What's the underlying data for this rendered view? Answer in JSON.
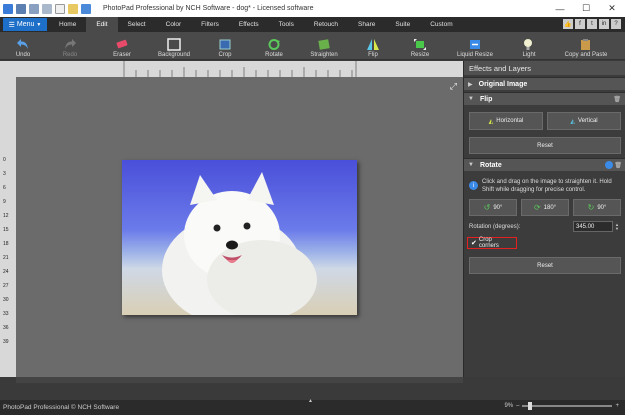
{
  "window": {
    "title": "PhotoPad Professional by NCH Software - dog* - Licensed software",
    "controls": [
      "—",
      "☐",
      "✕"
    ]
  },
  "menu": {
    "menu_label": "Menu",
    "tabs": [
      {
        "label": "Home"
      },
      {
        "label": "Edit",
        "active": true
      },
      {
        "label": "Select"
      },
      {
        "label": "Color"
      },
      {
        "label": "Filters"
      },
      {
        "label": "Effects"
      },
      {
        "label": "Tools"
      },
      {
        "label": "Retouch"
      },
      {
        "label": "Share"
      },
      {
        "label": "Suite"
      },
      {
        "label": "Custom"
      }
    ],
    "social": [
      "👍",
      "f",
      "t",
      "in",
      "?"
    ]
  },
  "toolbar": {
    "undo": "Undo",
    "redo": "Redo",
    "eraser": "Eraser",
    "background": "Background",
    "crop": "Crop",
    "rotate": "Rotate",
    "straighten": "Straighten",
    "flip": "Flip",
    "resize": "Resize",
    "liquid_resize": "Liquid Resize",
    "light": "Light",
    "copy_paste": "Copy and Paste"
  },
  "panel": {
    "title": "Effects and Layers",
    "original_image": "Original Image",
    "flip": {
      "title": "Flip",
      "horizontal": "Horizontal",
      "vertical": "Vertical",
      "reset": "Reset"
    },
    "rotate": {
      "title": "Rotate",
      "info": "Click and drag on the image to straighten it. Hold Shift while dragging for precise control.",
      "btn_90_left": "90°",
      "btn_180": "180°",
      "btn_90_right": "90°",
      "rotation_label": "Rotation (degrees):",
      "rotation_value": "345.00",
      "crop_corners": "Crop corners",
      "reset": "Reset"
    }
  },
  "status": {
    "copyright": "PhotoPad Professional © NCH Software",
    "zoom": "9%"
  },
  "ruler": {
    "left_ticks": [
      "0",
      "3",
      "6",
      "9",
      "12",
      "15",
      "18",
      "21",
      "24",
      "27",
      "30",
      "33",
      "36",
      "39"
    ]
  },
  "colors": {
    "accent": "#1e6fc8",
    "highlight_border": "#e52020"
  }
}
